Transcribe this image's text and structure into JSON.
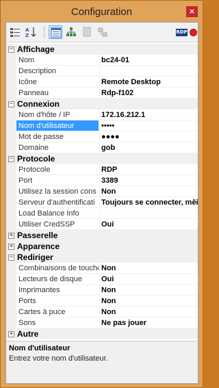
{
  "window": {
    "title": "Configuration",
    "close_glyph": "×"
  },
  "toolbar": {
    "icons": [
      "categorized-view-icon",
      "alphabetical-sort-icon",
      "property-pages-icon",
      "network-tree-icon",
      "host-list-icon",
      "network-sharing-icon",
      "rdp-icon",
      "record-icon"
    ],
    "rdp_badge": "RDP"
  },
  "sections": [
    {
      "label": "Affichage",
      "expanded": true,
      "toggle": "−",
      "rows": [
        {
          "name": "Nom",
          "value": "bc24-01"
        },
        {
          "name": "Description",
          "value": ""
        },
        {
          "name": "Icône",
          "value": "Remote Desktop"
        },
        {
          "name": "Panneau",
          "value": "Rdp-f102"
        }
      ]
    },
    {
      "label": "Connexion",
      "expanded": true,
      "toggle": "−",
      "rows": [
        {
          "name": "Nom d'hôte / IP",
          "value": "172.16.212.1"
        },
        {
          "name": "Nom d'utilisateur",
          "value": "•••••",
          "selected": true
        },
        {
          "name": "Mot de passe",
          "value": "●●●●"
        },
        {
          "name": "Domaine",
          "value": "gob"
        }
      ]
    },
    {
      "label": "Protocole",
      "expanded": true,
      "toggle": "−",
      "rows": [
        {
          "name": "Protocole",
          "value": "RDP"
        },
        {
          "name": "Port",
          "value": "3389"
        },
        {
          "name": "Utilisez la session cons",
          "value": "Non"
        },
        {
          "name": "Serveur d'authentificati",
          "value": "Toujours se connecter, mêi"
        },
        {
          "name": "Load Balance Info",
          "value": ""
        },
        {
          "name": "Utiliser CredSSP",
          "value": "Oui"
        }
      ]
    },
    {
      "label": "Passerelle",
      "expanded": false,
      "toggle": "+",
      "rows": []
    },
    {
      "label": "Apparence",
      "expanded": false,
      "toggle": "+",
      "rows": []
    },
    {
      "label": "Rediriger",
      "expanded": true,
      "toggle": "−",
      "rows": [
        {
          "name": "Combinaisons de touche",
          "value": "Non"
        },
        {
          "name": "Lecteurs de disque",
          "value": "Oui"
        },
        {
          "name": "Imprimantes",
          "value": "Non"
        },
        {
          "name": "Ports",
          "value": "Non"
        },
        {
          "name": "Cartes à puce",
          "value": "Non"
        },
        {
          "name": "Sons",
          "value": "Ne pas jouer"
        }
      ]
    },
    {
      "label": "Autre",
      "expanded": false,
      "toggle": "+",
      "rows": []
    }
  ],
  "help": {
    "title": "Nom d'utilisateur",
    "description": "Entrez votre nom d'utilisateur."
  },
  "colors": {
    "window_frame": "#e0a35a",
    "selection": "#3399ff",
    "close": "#c62828",
    "rdp_badge": "#1d3f8a"
  }
}
